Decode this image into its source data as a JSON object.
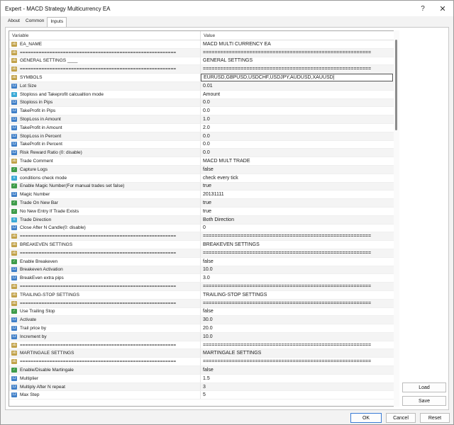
{
  "window": {
    "title": "Expert - MACD Strategy Multicurrency EA"
  },
  "tabs": [
    {
      "label": "About"
    },
    {
      "label": "Common"
    },
    {
      "label": "Inputs"
    }
  ],
  "grid": {
    "headers": {
      "variable": "Variable",
      "value": "Value"
    },
    "rows": [
      {
        "icon": "ab",
        "variable": "EA_NAME",
        "value": "MACD MULTI CURRENCY EA"
      },
      {
        "icon": "ab",
        "variable": "==========================================================",
        "value": "=========================================================="
      },
      {
        "icon": "ab",
        "variable": "GENERAL SETTINGS ____",
        "value": "GENERAL SETTINGS"
      },
      {
        "icon": "ab",
        "variable": "==========================================================",
        "value": "=========================================================="
      },
      {
        "icon": "ab",
        "variable": "SYMBOLS",
        "value": "EURUSD,GBPUSD,USDCHF,USDJPY,AUDUSD,XAUUSD|",
        "editing": true
      },
      {
        "icon": "num",
        "variable": "Lot Size",
        "value": "0.01"
      },
      {
        "icon": "enum",
        "variable": "Stoploss and Takeprofit calcualtion mode",
        "value": "Amount"
      },
      {
        "icon": "num",
        "variable": "Stoploss in Pips",
        "value": "0.0"
      },
      {
        "icon": "num",
        "variable": "TakeProfit in Pips",
        "value": "0.0"
      },
      {
        "icon": "num",
        "variable": "StopLoss in Amount",
        "value": "1.0"
      },
      {
        "icon": "num",
        "variable": "TakeProfit in Amount",
        "value": "2.0"
      },
      {
        "icon": "num",
        "variable": "StopLoss in Percent",
        "value": "0.0"
      },
      {
        "icon": "num",
        "variable": "TakeProfit in Percent",
        "value": "0.0"
      },
      {
        "icon": "num",
        "variable": "Risk Reward Ratio (0: disable)",
        "value": "0.0"
      },
      {
        "icon": "ab",
        "variable": "Trade Comment",
        "value": "MACD MULT TRADE"
      },
      {
        "icon": "bool",
        "variable": "Capture Logs",
        "value": "false"
      },
      {
        "icon": "enum",
        "variable": "conditions check mode",
        "value": "check every tick"
      },
      {
        "icon": "bool",
        "variable": "Enable Magic Number(For manual trades set false)",
        "value": "true"
      },
      {
        "icon": "num",
        "variable": "Magic Number",
        "value": "20131111"
      },
      {
        "icon": "bool",
        "variable": "Trade On New Bar",
        "value": "true"
      },
      {
        "icon": "bool",
        "variable": "No New Entry If Trade Exists",
        "value": "true"
      },
      {
        "icon": "enum",
        "variable": "Trade Direction",
        "value": "Both Direction"
      },
      {
        "icon": "num",
        "variable": "Close After N Candle(0: disable)",
        "value": "0"
      },
      {
        "icon": "ab",
        "variable": "==========================================================",
        "value": "=========================================================="
      },
      {
        "icon": "ab",
        "variable": "BREAKEVEN SETTINGS",
        "value": "BREAKEVEN SETTINGS"
      },
      {
        "icon": "ab",
        "variable": "==========================================================",
        "value": "=========================================================="
      },
      {
        "icon": "bool",
        "variable": "Enable Breakeven",
        "value": "false"
      },
      {
        "icon": "num",
        "variable": "Breakeven Activation",
        "value": "10.0"
      },
      {
        "icon": "num",
        "variable": "BreakEven extra pips",
        "value": "3.0"
      },
      {
        "icon": "ab",
        "variable": "==========================================================",
        "value": "=========================================================="
      },
      {
        "icon": "ab",
        "variable": "TRAILING-STOP SETTINGS",
        "value": "TRAILING-STOP SETTINGS"
      },
      {
        "icon": "ab",
        "variable": "==========================================================",
        "value": "=========================================================="
      },
      {
        "icon": "bool",
        "variable": "Use Trailing Stop",
        "value": "false"
      },
      {
        "icon": "num",
        "variable": "Activate",
        "value": "30.0"
      },
      {
        "icon": "num",
        "variable": "Trail price by",
        "value": "20.0"
      },
      {
        "icon": "num",
        "variable": "Increment by",
        "value": "10.0"
      },
      {
        "icon": "ab",
        "variable": "==========================================================",
        "value": "=========================================================="
      },
      {
        "icon": "ab",
        "variable": "MARTINGALE SETTINGS",
        "value": "MARTINGALE SETTINGS"
      },
      {
        "icon": "ab",
        "variable": "==========================================================",
        "value": "=========================================================="
      },
      {
        "icon": "bool",
        "variable": "Enable/Disable Martingale",
        "value": "false"
      },
      {
        "icon": "num",
        "variable": "Multiplier",
        "value": "1.5"
      },
      {
        "icon": "num",
        "variable": "Multiply After N repeat",
        "value": "3"
      },
      {
        "icon": "num",
        "variable": "Max Step",
        "value": "5"
      }
    ]
  },
  "buttons": {
    "load": "Load",
    "save": "Save",
    "ok": "OK",
    "cancel": "Cancel",
    "reset": "Reset"
  },
  "colors": {
    "accent": "#3a7bd5",
    "icon_ab": "#c2a24a",
    "icon_num": "#3f7fc8",
    "icon_enum": "#3aa9d6",
    "icon_bool": "#3f9c4a"
  }
}
